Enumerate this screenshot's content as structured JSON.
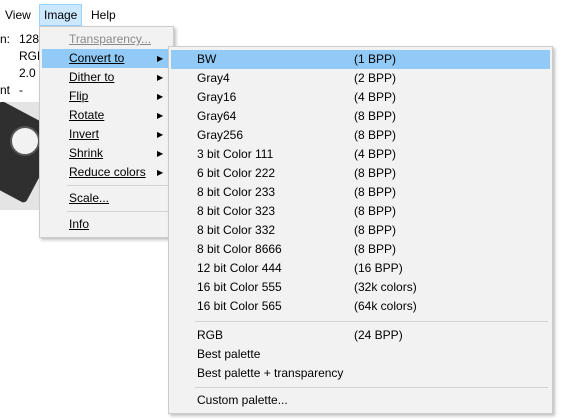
{
  "menubar": {
    "view": "View",
    "image": "Image",
    "help": "Help"
  },
  "background_info": {
    "line1_label": "n:",
    "line1_value": "128",
    "line2_value": "RGB",
    "line3_value": "2.0",
    "line4_label": "nt",
    "line4_value": "-"
  },
  "image_menu": {
    "items": [
      {
        "label": "Transparency...",
        "disabled": true
      },
      {
        "label": "Convert to",
        "submenu": true
      },
      {
        "label": "Dither to",
        "submenu": true
      },
      {
        "label": "Flip",
        "submenu": true
      },
      {
        "label": "Rotate",
        "submenu": true
      },
      {
        "label": "Invert",
        "submenu": true
      },
      {
        "label": "Shrink",
        "submenu": true
      },
      {
        "label": "Reduce colors",
        "submenu": true
      },
      {
        "label": "Scale..."
      },
      {
        "label": "Info"
      }
    ],
    "arrow": "▶"
  },
  "convert_menu": {
    "items": [
      {
        "label": "BW",
        "bpp": "(1 BPP)"
      },
      {
        "label": "Gray4",
        "bpp": "(2 BPP)"
      },
      {
        "label": "Gray16",
        "bpp": "(4 BPP)"
      },
      {
        "label": "Gray64",
        "bpp": "(8 BPP)"
      },
      {
        "label": "Gray256",
        "bpp": "(8 BPP)"
      },
      {
        "label": "3 bit Color 111",
        "bpp": "(4 BPP)"
      },
      {
        "label": "6 bit Color 222",
        "bpp": "(8 BPP)"
      },
      {
        "label": "8 bit Color 233",
        "bpp": "(8 BPP)"
      },
      {
        "label": "8 bit Color 323",
        "bpp": "(8 BPP)"
      },
      {
        "label": "8 bit Color 332",
        "bpp": "(8 BPP)"
      },
      {
        "label": "8 bit Color 8666",
        "bpp": "(8 BPP)"
      },
      {
        "label": "12 bit Color 444",
        "bpp": "(16 BPP)"
      },
      {
        "label": "16 bit Color 555",
        "bpp": "(32k colors)"
      },
      {
        "label": "16 bit Color 565",
        "bpp": "(64k colors)"
      },
      {
        "label": "RGB",
        "bpp": "(24 BPP)"
      },
      {
        "label": "Best palette",
        "bpp": ""
      },
      {
        "label": "Best palette + transparency",
        "bpp": ""
      },
      {
        "label": "Custom palette...",
        "bpp": ""
      }
    ]
  }
}
